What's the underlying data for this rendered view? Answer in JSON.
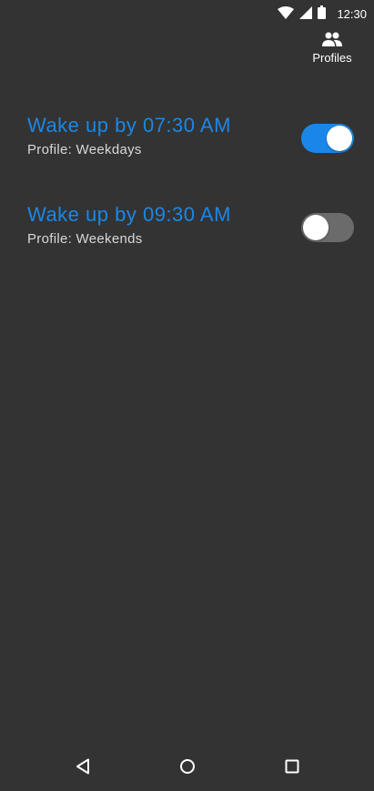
{
  "status_bar": {
    "time": "12:30",
    "icons": [
      "wifi-icon",
      "cellular-signal-icon",
      "battery-icon"
    ]
  },
  "app_bar": {
    "profiles_label": "Profiles",
    "profiles_icon": "people-icon"
  },
  "alarms": [
    {
      "time_text": "Wake up by 07:30 AM",
      "profile_text": "Profile: Weekdays",
      "enabled": true
    },
    {
      "time_text": "Wake up by 09:30 AM",
      "profile_text": "Profile: Weekends",
      "enabled": false
    }
  ],
  "nav_bar": {
    "buttons": [
      "back-icon",
      "home-icon",
      "recents-icon"
    ]
  },
  "colors": {
    "background": "#333333",
    "accent": "#1a87e8",
    "toggle_off_track": "#6b6b6b",
    "secondary_text": "#d8d8d8"
  }
}
